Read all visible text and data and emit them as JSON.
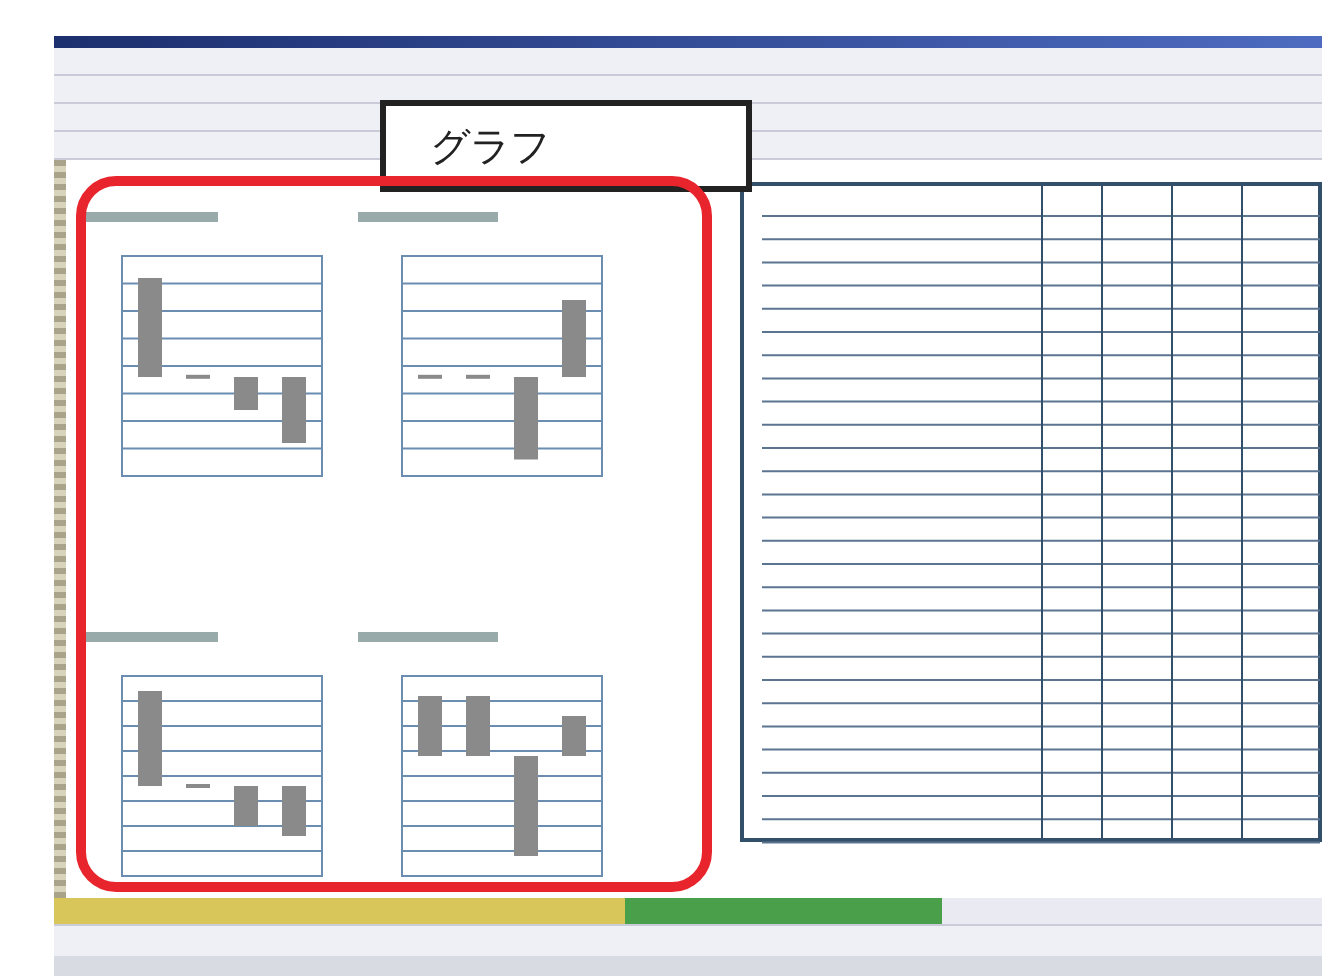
{
  "callout": {
    "label": "グラフ"
  }
}
